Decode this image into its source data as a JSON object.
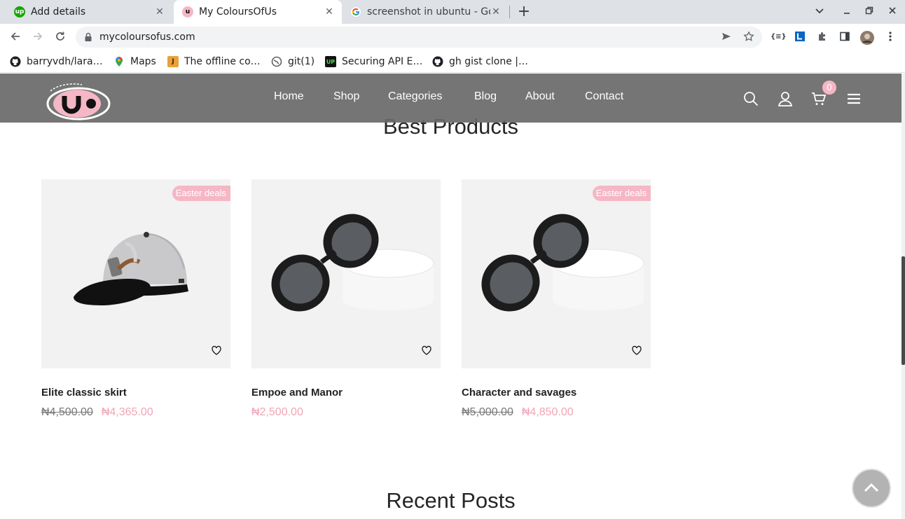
{
  "browser": {
    "tabs": [
      {
        "title": "Add details",
        "favicon": "upwork-icon",
        "active": false
      },
      {
        "title": "My ColoursOfUs",
        "favicon": "site-logo-icon",
        "active": true
      },
      {
        "title": "screenshot in ubuntu - Go",
        "favicon": "google-icon",
        "active": false
      }
    ],
    "url": "mycoloursofus.com",
    "bookmarks": [
      {
        "label": "barryvdh/lara…",
        "icon": "github-icon"
      },
      {
        "label": "Maps",
        "icon": "maps-icon"
      },
      {
        "label": "The offline co…",
        "icon": "bookmark-j-icon"
      },
      {
        "label": "git(1)",
        "icon": "globe-icon"
      },
      {
        "label": "Securing API E…",
        "icon": "bookmark-up-icon"
      },
      {
        "label": "gh gist clone |…",
        "icon": "github-icon"
      }
    ],
    "extension_label": "{≡}"
  },
  "site": {
    "nav": [
      "Home",
      "Shop",
      "Categories",
      "Blog",
      "About",
      "Contact"
    ],
    "cart_count": "0",
    "best_products_title": "Best Products",
    "recent_posts_title": "Recent Posts",
    "products": [
      {
        "name": "Elite classic skirt",
        "old_price": "₦4,500.00",
        "price": "₦4,365.00",
        "badge": "Easter deals",
        "image": "cap-image"
      },
      {
        "name": "Empoe and Manor",
        "old_price": "",
        "price": "₦2,500.00",
        "badge": "",
        "image": "sunglasses-image"
      },
      {
        "name": "Character and savages",
        "old_price": "₦5,000.00",
        "price": "₦4,850.00",
        "badge": "Easter deals",
        "image": "sunglasses-image"
      }
    ]
  },
  "colors": {
    "header_bg": "#696969",
    "accent_pink": "#f5b7c5",
    "price_pink": "#f0a5b8"
  }
}
